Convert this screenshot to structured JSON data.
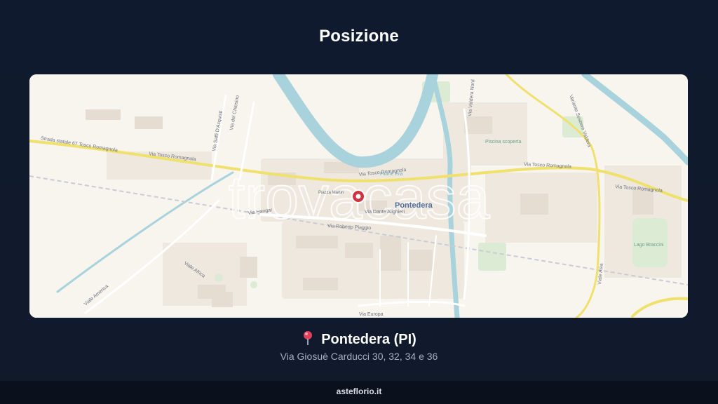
{
  "page": {
    "title": "Posizione"
  },
  "map": {
    "watermark": "trovacasa",
    "city_label": "Pontedera",
    "streets": {
      "s1": "Strada statale 67 Tosco Romagnola",
      "s2": "Via Tosco Romagnola",
      "s3": "Via Tosco Romagnola",
      "s4": "Via Tosco Romagnola",
      "s5": "Via Tosco Romagnola",
      "s6": "Via Hangar",
      "s7": "Via Roberto Piaggio",
      "s8": "Via Dante Alighieri",
      "s9": "Viale America",
      "s10": "Viale Africa",
      "s11": "Viale Asia",
      "s12": "Via Saffi D'Acquisti",
      "s13": "Via del Chiesino",
      "s14": "Via Valdera Nord",
      "s15": "Variante Sestiere Valdera",
      "s16": "Via Europa",
      "s17": "Fiume Era",
      "s18": "Piazza Martiri"
    },
    "poi": {
      "p1": "Piscina scoperta",
      "p2": "Lago Braccini"
    }
  },
  "location": {
    "pin_icon": "map-pin-icon",
    "city": "Pontedera (PI)",
    "address": "Via Giosuè Carducci 30, 32, 34 e 36"
  },
  "footer": {
    "site": "asteflorio.it"
  },
  "colors": {
    "background": "#0f1a2e",
    "map_bg": "#f8f4ee",
    "water": "#a8d3dd",
    "marker": "#d1333f"
  }
}
